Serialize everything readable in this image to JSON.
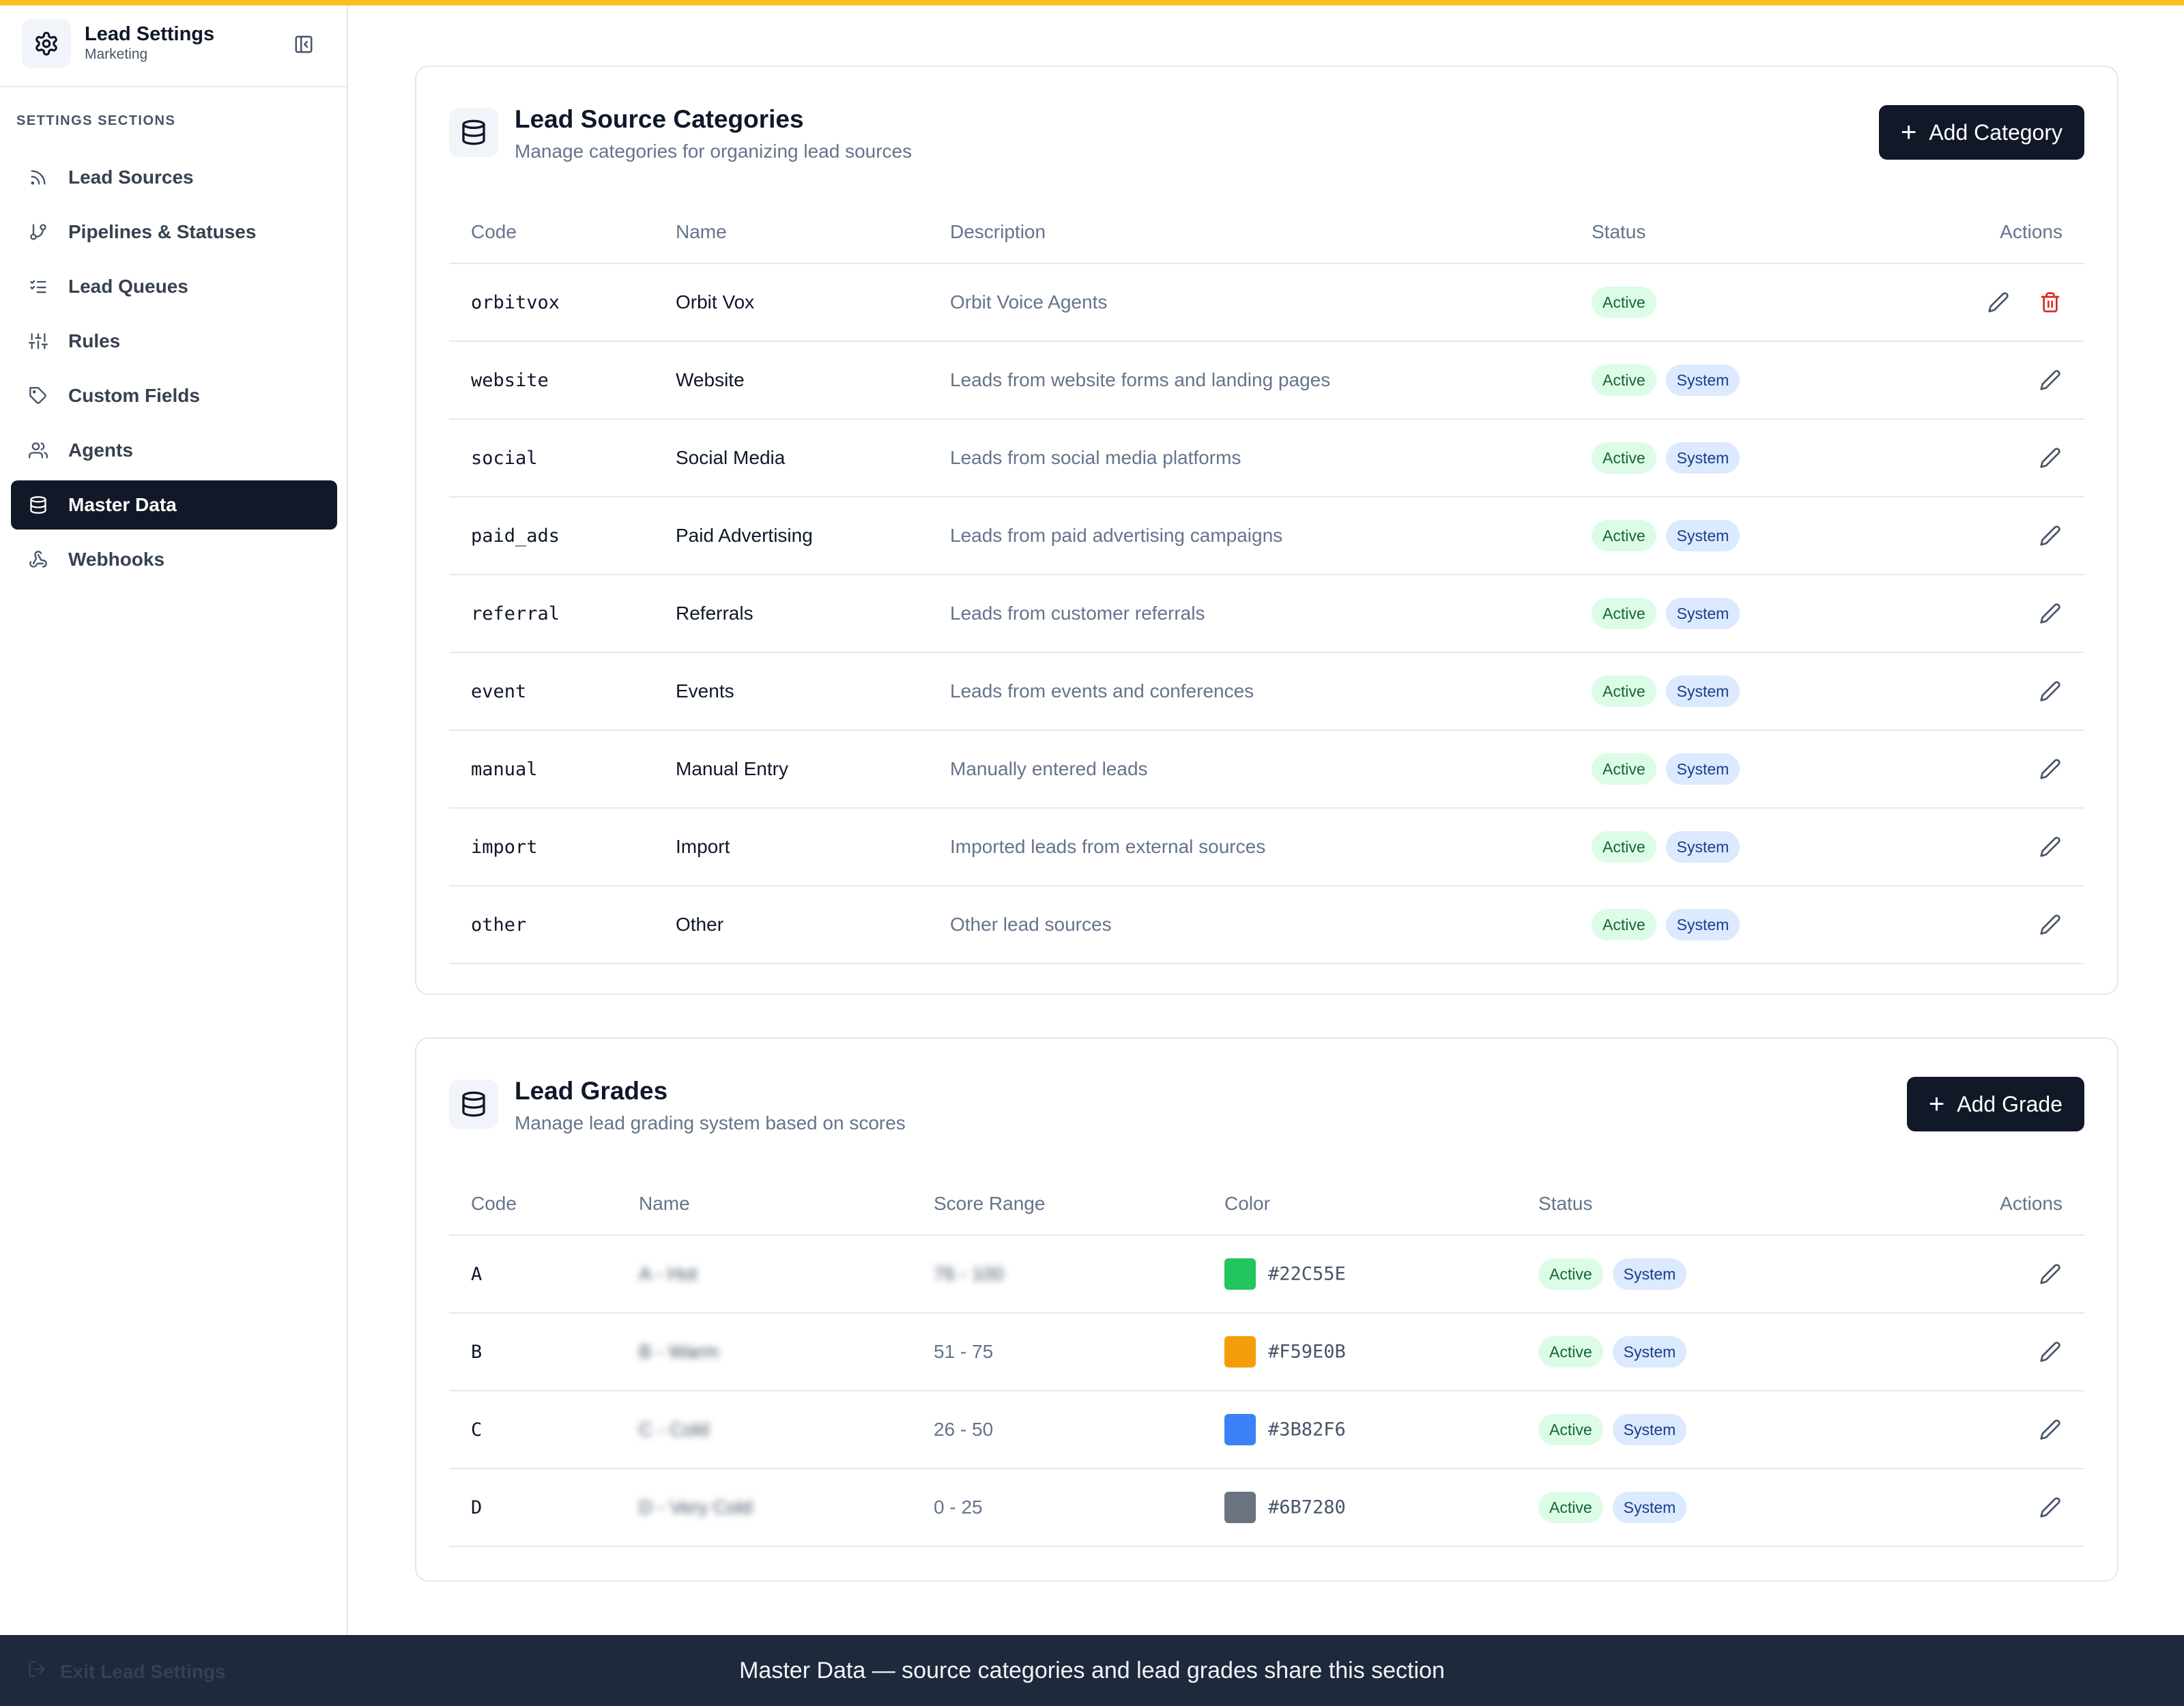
{
  "sidebar": {
    "title": "Lead Settings",
    "subtitle": "Marketing",
    "section_label": "SETTINGS SECTIONS",
    "items": [
      {
        "label": "Lead Sources",
        "icon": "rss-icon"
      },
      {
        "label": "Pipelines & Statuses",
        "icon": "git-branch-icon"
      },
      {
        "label": "Lead Queues",
        "icon": "list-checks-icon"
      },
      {
        "label": "Rules",
        "icon": "sliders-icon"
      },
      {
        "label": "Custom Fields",
        "icon": "tag-icon"
      },
      {
        "label": "Agents",
        "icon": "users-icon"
      },
      {
        "label": "Master Data",
        "icon": "database-icon",
        "active": true
      },
      {
        "label": "Webhooks",
        "icon": "webhook-icon"
      }
    ],
    "exit_label": "Exit Lead Settings"
  },
  "categories": {
    "title": "Lead Source Categories",
    "description": "Manage categories for organizing lead sources",
    "add_button": "Add Category",
    "columns": [
      "Code",
      "Name",
      "Description",
      "Status",
      "Actions"
    ],
    "rows": [
      {
        "code": "orbitvox",
        "name": "Orbit Vox",
        "description": "Orbit Voice Agents",
        "status": "Active",
        "system": null
      },
      {
        "code": "website",
        "name": "Website",
        "description": "Leads from website forms and landing pages",
        "status": "Active",
        "system": "System"
      },
      {
        "code": "social",
        "name": "Social Media",
        "description": "Leads from social media platforms",
        "status": "Active",
        "system": "System"
      },
      {
        "code": "paid_ads",
        "name": "Paid Advertising",
        "description": "Leads from paid advertising campaigns",
        "status": "Active",
        "system": "System"
      },
      {
        "code": "referral",
        "name": "Referrals",
        "description": "Leads from customer referrals",
        "status": "Active",
        "system": "System"
      },
      {
        "code": "event",
        "name": "Events",
        "description": "Leads from events and conferences",
        "status": "Active",
        "system": "System"
      },
      {
        "code": "manual",
        "name": "Manual Entry",
        "description": "Manually entered leads",
        "status": "Active",
        "system": "System"
      },
      {
        "code": "import",
        "name": "Import",
        "description": "Imported leads from external sources",
        "status": "Active",
        "system": "System"
      },
      {
        "code": "other",
        "name": "Other",
        "description": "Other lead sources",
        "status": "Active",
        "system": "System"
      }
    ]
  },
  "grades": {
    "title": "Lead Grades",
    "description": "Manage lead grading system based on scores",
    "add_button": "Add Grade",
    "columns": [
      "Code",
      "Name",
      "Score Range",
      "Color",
      "Status",
      "Actions"
    ],
    "rows": [
      {
        "code": "A",
        "name": "A - Hot",
        "range": "76 - 100",
        "color": "#22C55E",
        "status": "Active",
        "system": "System",
        "name_blurred": true,
        "range_blurred": true
      },
      {
        "code": "B",
        "name": "B - Warm",
        "range": "51 - 75",
        "color": "#F59E0B",
        "status": "Active",
        "system": "System",
        "name_blurred": true,
        "range_blurred": false
      },
      {
        "code": "C",
        "name": "C - Cold",
        "range": "26 - 50",
        "color": "#3B82F6",
        "status": "Active",
        "system": "System",
        "name_blurred": true,
        "range_blurred": false
      },
      {
        "code": "D",
        "name": "D - Very Cold",
        "range": "0 - 25",
        "color": "#6B7280",
        "status": "Active",
        "system": "System",
        "name_blurred": true,
        "range_blurred": false
      }
    ]
  },
  "footer": {
    "caption": "Master Data — source categories and lead grades share this section"
  },
  "colors": {
    "accent_bar": "#fbbf24",
    "primary": "#111827",
    "active_badge_bg": "#dcfce7",
    "system_badge_bg": "#dbeafe",
    "delete": "#dc2626"
  }
}
